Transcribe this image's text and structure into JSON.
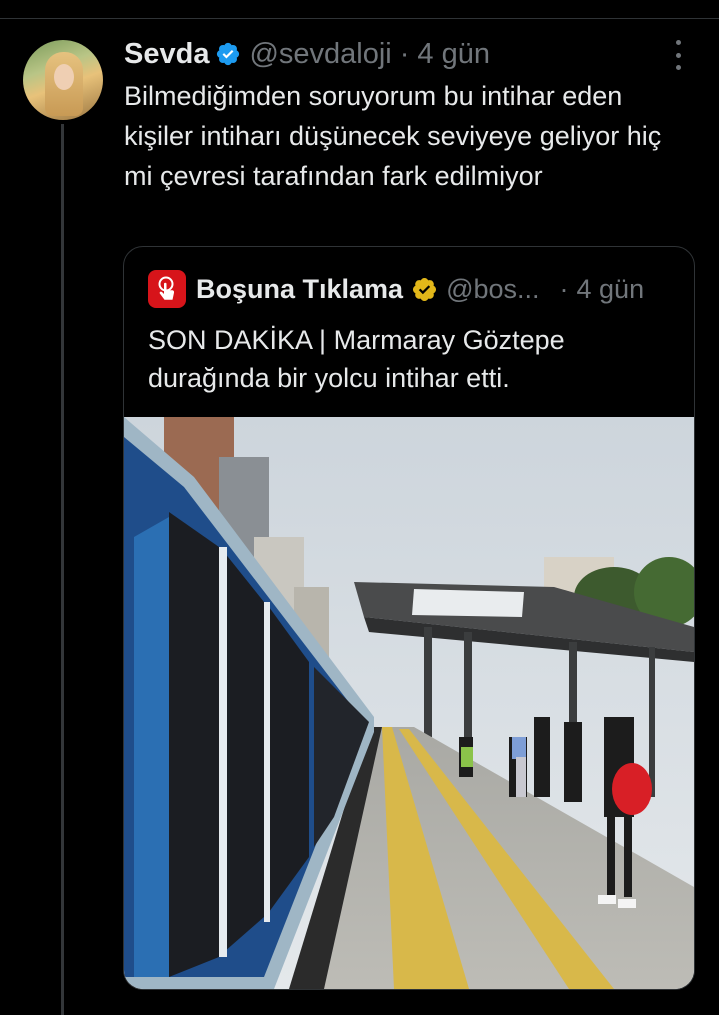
{
  "tweet": {
    "author_name": "Sevda",
    "handle": "@sevdaloji",
    "separator": "·",
    "time": "4 gün",
    "text": "Bilmediğimden soruyorum bu intihar eden kişiler intiharı düşünecek seviyeye geliyor hiç mi çevresi tarafından fark edilmiyor",
    "verified_color": "#1d9bf0",
    "avatar_icon": "user-avatar-photo",
    "more_icon": "more-vertical-icon"
  },
  "quote": {
    "author_name": "Boşuna Tıklama",
    "handle": "@bos...",
    "separator": "·",
    "time": "4 gün",
    "text": "SON DAKİKA | Marmaray Göztepe durağında bir yolcu intihar etti.",
    "logo_color": "#d7141a",
    "badge_color": "#e2b719",
    "logo_icon": "tap-hand-icon",
    "image_description_icon": "train-station-photo"
  },
  "colors": {
    "background": "#000000",
    "text_primary": "#e7e9ea",
    "text_secondary": "#71767b",
    "border": "#2f3336"
  }
}
